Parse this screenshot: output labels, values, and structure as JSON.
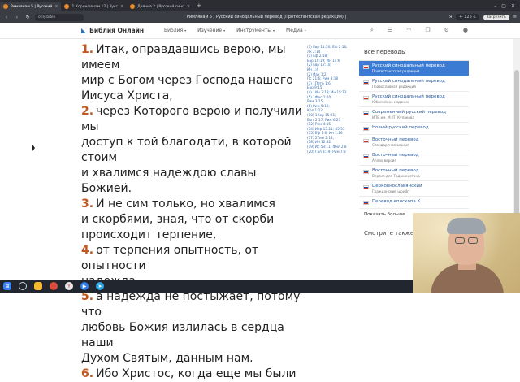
{
  "browser": {
    "tabs": [
      {
        "label": "Римлянам 5 | Русский",
        "active": true
      },
      {
        "label": "1 Коринфянам 12 | Русс",
        "active": false
      },
      {
        "label": "Деяния 2 | Русский сино",
        "active": false
      }
    ],
    "url": "only.bible",
    "page_title": "Римлянам 5 / Русский синодальный перевод (Протестантская редакция) |",
    "right_badge": "← 125 K",
    "download_label": "Загрузить",
    "lang_letter": "Я"
  },
  "site": {
    "logo_text": "Библия Онлайн",
    "menu": [
      "Библия",
      "Изучение",
      "Инструменты",
      "Медиа"
    ],
    "header_icons": [
      "search-icon",
      "list-icon",
      "headphones-icon",
      "copy-icon",
      "settings-icon",
      "user-icon"
    ]
  },
  "verses": [
    {
      "num": "1.",
      "lines": [
        "Итак, оправдавшись верою, мы имеем",
        "мир с Богом через Господа нашего",
        "Иисуса Христа,"
      ]
    },
    {
      "num": "2.",
      "lines": [
        "через Которого верою и получили мы",
        "доступ к той благодати, в которой стоим",
        "и хвалимся надеждою славы Божией."
      ]
    },
    {
      "num": "3.",
      "lines": [
        "И не сим только, но хвалимся",
        "и скорбями, зная, что от скорби",
        "происходит терпение,"
      ]
    },
    {
      "num": "4.",
      "lines": [
        "от терпения опытность, от опытности",
        "надежда,"
      ]
    },
    {
      "num": "5.",
      "lines": [
        "а надежда не постыжает, потому что",
        "любовь Божия излилась в сердца наши",
        "Духом Святым, данным нам."
      ]
    },
    {
      "num": "6.",
      "lines": [
        "Ибо Христос, когда еще мы были"
      ]
    }
  ],
  "cross_refs": [
    "(1) Евр 11:20; Еф 2:16;",
    "Лк 2:14",
    "(1) Еф 2:18;",
    "Евр 10:19; Ин 14:6",
    "(2) Евр 12:10;",
    "Ин 1:4",
    "(2) Иак 1:2;",
    "Пс 21:6; Рим 8:18",
    "(3) 1Петр 1:6;",
    "Евр 9:15",
    "(4) 1Ин 3:18; Ин 15:13",
    "(5) 1Фес 1:10;",
    "Рим 3:25",
    "(6) Рим 5:10;",
    "Кол 1:22",
    "(10) 1Кор 15:21;",
    "Быт 2:17; Рим 6:23",
    "(12) Рим 4:15",
    "(14) Иер 15:21; 45:55",
    "(15) Еф 1:6; Ин 1:16",
    "(17) 2Тим 2:12;",
    "(18) Ин 12:32",
    "(19) Ис 53:11; Фил 2:8",
    "(20) Гал 3:19; Рим 7:8"
  ],
  "sidebar": {
    "title": "Все переводы",
    "items": [
      {
        "name": "Русский синодальный перевод",
        "sub": "Протестантская редакция",
        "active": true
      },
      {
        "name": "Русский синодальный перевод",
        "sub": "Православная редакция",
        "active": false
      },
      {
        "name": "Русский синодальный перевод",
        "sub": "Юбилейное издание",
        "active": false
      },
      {
        "name": "Современный русский перевод",
        "sub": "ИПБ им. М. П. Кулакова",
        "active": false
      },
      {
        "name": "Новый русский перевод",
        "sub": "",
        "active": false
      },
      {
        "name": "Восточный перевод",
        "sub": "Стандартная версия",
        "active": false
      },
      {
        "name": "Восточный перевод",
        "sub": "Аллах версия",
        "active": false
      },
      {
        "name": "Восточный перевод",
        "sub": "Версия для Таджикистана",
        "active": false
      },
      {
        "name": "Церковнославянский",
        "sub": "Гражданский шрифт",
        "active": false
      },
      {
        "name": "Перевод епископа К",
        "sub": "",
        "active": false
      }
    ],
    "more_label": "Показать больше",
    "see_also_label": "Смотрите также"
  },
  "taskbar": {
    "icons": [
      "windows-icon",
      "search-icon",
      "explorer-icon",
      "chrome-icon",
      "yandex-icon",
      "media-icon",
      "telegram-icon"
    ]
  }
}
